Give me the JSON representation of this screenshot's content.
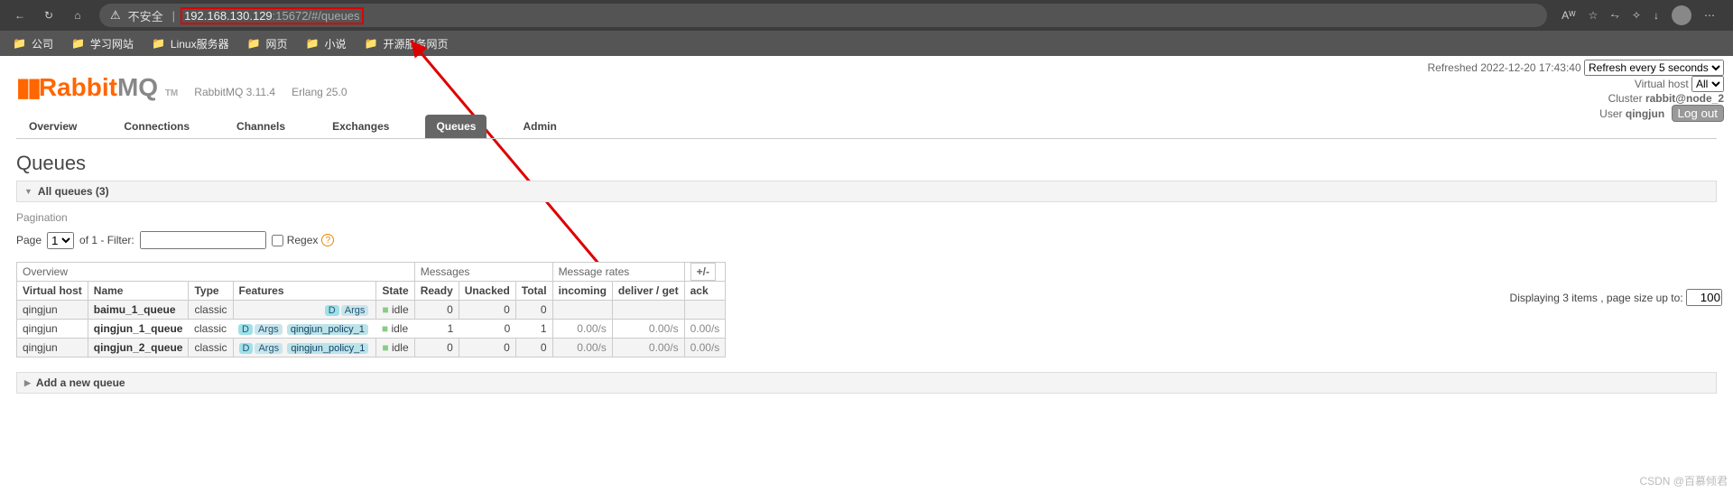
{
  "browser": {
    "insecure": "不安全",
    "url_ip": "192.168.130.129",
    "url_rest": ":15672/#/queues",
    "bookmarks": [
      "公司",
      "学习网站",
      "Linux服务器",
      "网页",
      "小说",
      "开源服务网页"
    ]
  },
  "top": {
    "refreshed": "Refreshed 2022-12-20 17:43:40",
    "refresh_select": "Refresh every 5 seconds",
    "vhost_label": "Virtual host",
    "vhost_value": "All",
    "cluster_label": "Cluster",
    "cluster_value": "rabbit@node_2",
    "user_label": "User",
    "user_value": "qingjun",
    "logout": "Log out"
  },
  "logo": {
    "name": "Rabbit",
    "mq": "MQ",
    "tm": "TM",
    "ver": "RabbitMQ 3.11.4",
    "erl": "Erlang 25.0"
  },
  "tabs": [
    "Overview",
    "Connections",
    "Channels",
    "Exchanges",
    "Queues",
    "Admin"
  ],
  "page": {
    "title": "Queues",
    "all_queues": "All queues (3)",
    "pagination": "Pagination",
    "page_label": "Page",
    "page_value": "1",
    "of": "of 1  - Filter:",
    "regex": "Regex",
    "displaying": "Displaying 3 items , page size up to:",
    "page_size": "100",
    "add": "Add a new queue"
  },
  "grp": {
    "overview": "Overview",
    "messages": "Messages",
    "rates": "Message rates",
    "pm": "+/-"
  },
  "hd": {
    "vhost": "Virtual host",
    "name": "Name",
    "type": "Type",
    "features": "Features",
    "state": "State",
    "ready": "Ready",
    "unacked": "Unacked",
    "total": "Total",
    "incoming": "incoming",
    "deliver": "deliver / get",
    "ack": "ack"
  },
  "rows": [
    {
      "vhost": "qingjun",
      "name": "baimu_1_queue",
      "type": "classic",
      "d": "D",
      "a": "Args",
      "policy": "",
      "state": "idle",
      "ready": "0",
      "unacked": "0",
      "total": "0",
      "in": "",
      "del": "",
      "ack": ""
    },
    {
      "vhost": "qingjun",
      "name": "qingjun_1_queue",
      "type": "classic",
      "d": "D",
      "a": "Args",
      "policy": "qingjun_policy_1",
      "state": "idle",
      "ready": "1",
      "unacked": "0",
      "total": "1",
      "in": "0.00/s",
      "del": "0.00/s",
      "ack": "0.00/s",
      "hl": true
    },
    {
      "vhost": "qingjun",
      "name": "qingjun_2_queue",
      "type": "classic",
      "d": "D",
      "a": "Args",
      "policy": "qingjun_policy_1",
      "state": "idle",
      "ready": "0",
      "unacked": "0",
      "total": "0",
      "in": "0.00/s",
      "del": "0.00/s",
      "ack": "0.00/s"
    }
  ],
  "watermark": "CSDN @百慕倾君"
}
